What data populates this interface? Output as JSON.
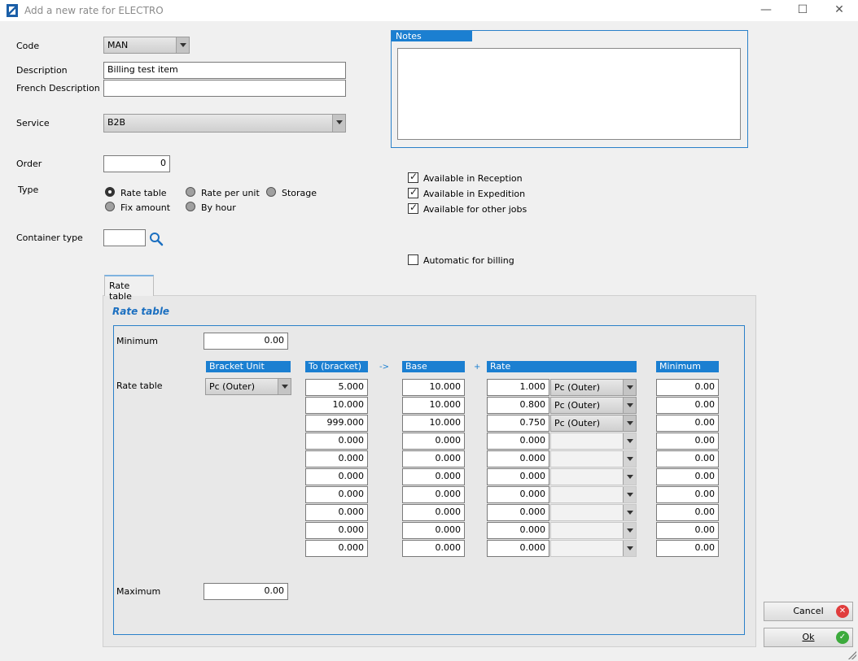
{
  "window": {
    "title": "Add a new rate for ELECTRO",
    "minimize": "—",
    "maximize": "☐",
    "close": "✕"
  },
  "form": {
    "code_label": "Code",
    "code_value": "MAN",
    "description_label": "Description",
    "description_value": "Billing test item",
    "french_description_label": "French Description",
    "french_description_value": "",
    "service_label": "Service",
    "service_value": "B2B",
    "order_label": "Order",
    "order_value": "0",
    "type_label": "Type",
    "type_options": [
      "Rate table",
      "Rate per unit",
      "Storage",
      "Fix amount",
      "By hour"
    ],
    "type_selected": "Rate table",
    "container_type_label": "Container type",
    "container_type_value": ""
  },
  "notes": {
    "label": "Notes",
    "value": ""
  },
  "availability": {
    "reception_label": "Available in Reception",
    "reception_checked": true,
    "expedition_label": "Available in Expedition",
    "expedition_checked": true,
    "other_jobs_label": "Available for other jobs",
    "other_jobs_checked": true,
    "auto_billing_label": "Automatic for billing",
    "auto_billing_checked": false
  },
  "tabs": [
    {
      "label": "Rate table",
      "active": true
    }
  ],
  "rate_table": {
    "title": "Rate table",
    "minimum_label": "Minimum",
    "minimum_value": "0.00",
    "maximum_label": "Maximum",
    "maximum_value": "0.00",
    "row_label": "Rate table",
    "headers": {
      "bracket_unit": "Bracket Unit",
      "to_bracket": "To (bracket)",
      "arrow": "->",
      "base": "Base",
      "plus": "+",
      "rate": "Rate",
      "minimum": "Minimum"
    },
    "bracket_unit_value": "Pc (Outer)",
    "rows": [
      {
        "to": "5.000",
        "base": "10.000",
        "rate": "1.000",
        "unit": "Pc (Outer)",
        "minimum": "0.00"
      },
      {
        "to": "10.000",
        "base": "10.000",
        "rate": "0.800",
        "unit": "Pc (Outer)",
        "minimum": "0.00"
      },
      {
        "to": "999.000",
        "base": "10.000",
        "rate": "0.750",
        "unit": "Pc (Outer)",
        "minimum": "0.00"
      },
      {
        "to": "0.000",
        "base": "0.000",
        "rate": "0.000",
        "unit": "",
        "minimum": "0.00"
      },
      {
        "to": "0.000",
        "base": "0.000",
        "rate": "0.000",
        "unit": "",
        "minimum": "0.00"
      },
      {
        "to": "0.000",
        "base": "0.000",
        "rate": "0.000",
        "unit": "",
        "minimum": "0.00"
      },
      {
        "to": "0.000",
        "base": "0.000",
        "rate": "0.000",
        "unit": "",
        "minimum": "0.00"
      },
      {
        "to": "0.000",
        "base": "0.000",
        "rate": "0.000",
        "unit": "",
        "minimum": "0.00"
      },
      {
        "to": "0.000",
        "base": "0.000",
        "rate": "0.000",
        "unit": "",
        "minimum": "0.00"
      },
      {
        "to": "0.000",
        "base": "0.000",
        "rate": "0.000",
        "unit": "",
        "minimum": "0.00"
      }
    ]
  },
  "buttons": {
    "cancel_label": "Cancel",
    "ok_label": "Ok"
  },
  "colors": {
    "accent": "#1b7fd1",
    "cancel_icon": "#e03c3c",
    "ok_icon": "#3caa3c"
  }
}
